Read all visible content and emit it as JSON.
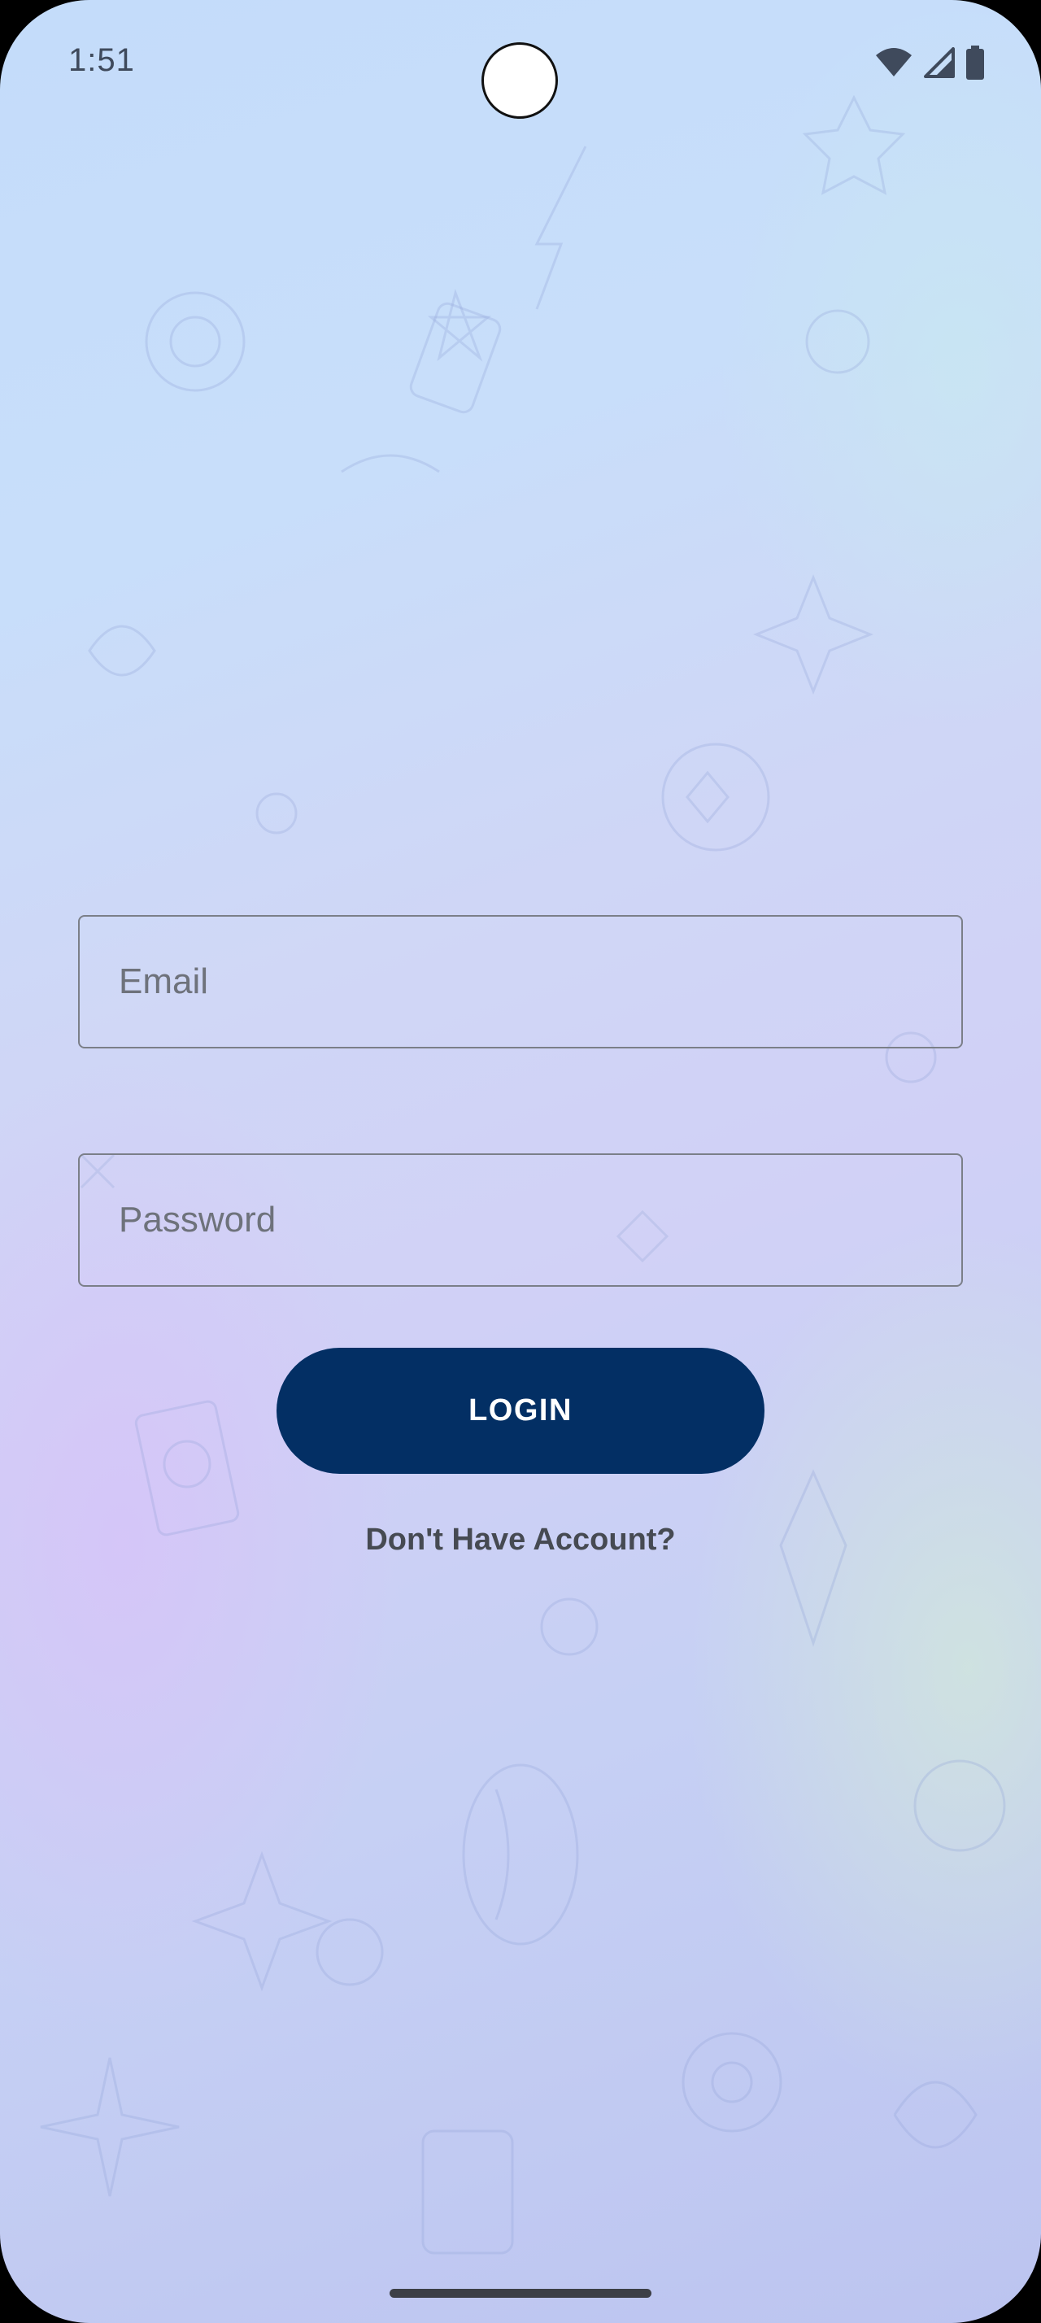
{
  "status_bar": {
    "time": "1:51",
    "icons": [
      "wifi-icon",
      "cellular-signal-icon",
      "battery-icon"
    ]
  },
  "login_form": {
    "email_placeholder": "Email",
    "password_placeholder": "Password",
    "login_label": "LOGIN",
    "signup_link": "Don't Have Account?"
  },
  "colors": {
    "login_button": "#032f64",
    "field_border": "#7b7f88",
    "link_text": "#464a52"
  }
}
